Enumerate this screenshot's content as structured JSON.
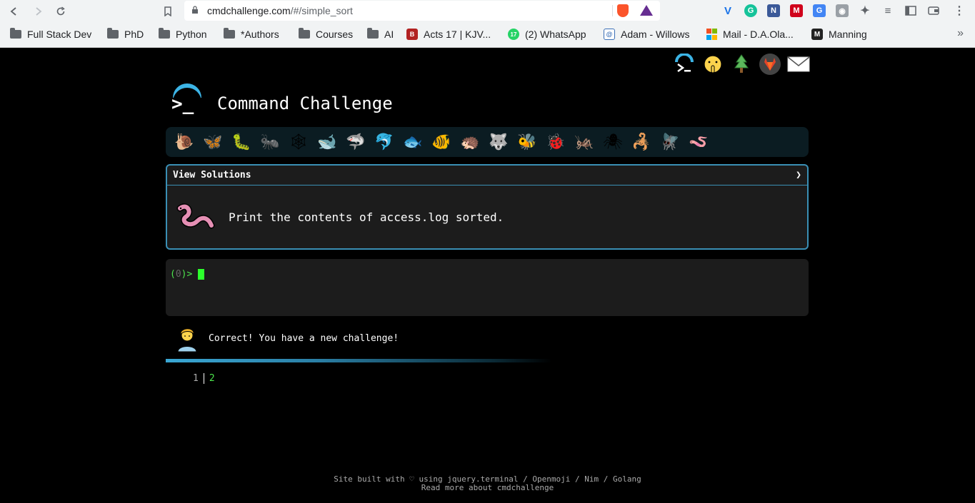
{
  "browser": {
    "url_host": "cmdchallenge.com",
    "url_path": "/#/simple_sort",
    "bookmarks": [
      {
        "label": "Full Stack Dev",
        "type": "folder"
      },
      {
        "label": "PhD",
        "type": "folder"
      },
      {
        "label": "Python",
        "type": "folder"
      },
      {
        "label": "*Authors",
        "type": "folder"
      },
      {
        "label": "Courses",
        "type": "folder"
      },
      {
        "label": "AI",
        "type": "folder"
      },
      {
        "label": "Acts 17 | KJV...",
        "type": "site"
      },
      {
        "label": "(2) WhatsApp",
        "type": "site"
      },
      {
        "label": "Adam - Willows",
        "type": "site"
      },
      {
        "label": "Mail - D.A.Ola...",
        "type": "site"
      },
      {
        "label": "Manning",
        "type": "site"
      }
    ],
    "more": "»",
    "whatsapp_badge": "17"
  },
  "page": {
    "title": "Command Challenge",
    "logo_prompt": ">_",
    "view_solutions_label": "View Solutions",
    "view_solutions_arrow": "❯",
    "challenge_text": "Print the contents of access.log sorted.",
    "prompt_open": "(",
    "prompt_num": "0",
    "prompt_close": ")>",
    "status_text": "Correct! You have a new challenge!",
    "output_line_number": "1",
    "output_value": "2",
    "footer_line1": "Site built with ♡ using jquery.terminal / Openmoji / Nim / Golang",
    "footer_line2": "Read more about cmdchallenge",
    "animals": [
      "🐌",
      "🦋",
      "🐛",
      "🐜",
      "🕸",
      "🐋",
      "🦈",
      "🐬",
      "🐟",
      "🐠",
      "🦔",
      "🐺",
      "🐝",
      "🐞",
      "🦗",
      "🕷",
      "🦂",
      "🪰",
      "🪱"
    ],
    "top_icons": [
      "terminal-icon",
      "shushing-face-icon",
      "tree-icon",
      "gitlab-icon",
      "envelope-icon"
    ]
  },
  "colors": {
    "accent": "#3a8fb5",
    "terminal_green": "#4ce64c",
    "cursor": "#2cff2c",
    "background": "#000000"
  }
}
